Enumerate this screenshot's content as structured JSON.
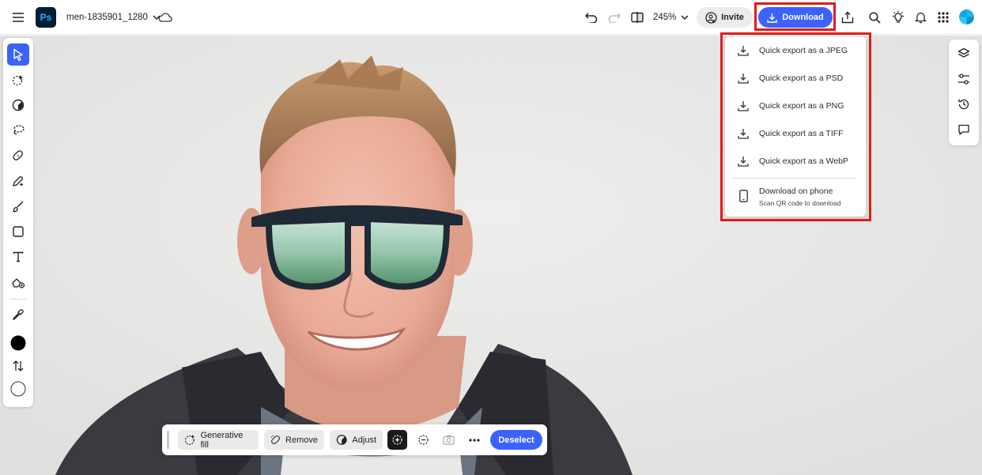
{
  "app": {
    "logo_text": "Ps",
    "document_title": "men-1835901_1280",
    "zoom_level": "245%"
  },
  "header": {
    "invite_label": "Invite",
    "download_label": "Download"
  },
  "download_menu": {
    "items": [
      {
        "label": "Quick export as a JPEG",
        "icon": "download-icon"
      },
      {
        "label": "Quick export as a PSD",
        "icon": "download-icon"
      },
      {
        "label": "Quick export as a PNG",
        "icon": "download-icon"
      },
      {
        "label": "Quick export as a TIFF",
        "icon": "download-icon"
      },
      {
        "label": "Quick export as a WebP",
        "icon": "download-icon"
      }
    ],
    "phone": {
      "label": "Download on phone",
      "sublabel": "Scan QR code to download",
      "icon": "phone-icon"
    }
  },
  "left_toolbar": {
    "tools": [
      "select-tool",
      "quick-select-tool",
      "adjust-tool",
      "lasso-tool",
      "healing-tool",
      "generative-tool",
      "brush-tool",
      "shape-tool",
      "text-tool",
      "fill-tool",
      "eyedropper-tool",
      "foreground-color",
      "swap-colors",
      "background-color"
    ],
    "foreground_color": "#000000",
    "background_color": "#ffffff"
  },
  "right_toolbar": {
    "tools": [
      "layers-icon",
      "adjustments-icon",
      "history-icon",
      "comments-icon"
    ]
  },
  "context_bar": {
    "generative_fill_label": "Generative fill",
    "remove_label": "Remove",
    "adjust_label": "Adjust",
    "deselect_label": "Deselect"
  },
  "colors": {
    "accent": "#3b63fb",
    "highlight": "#e01b1b",
    "ps_logo_bg": "#001e36",
    "ps_logo_text": "#31a8ff"
  }
}
